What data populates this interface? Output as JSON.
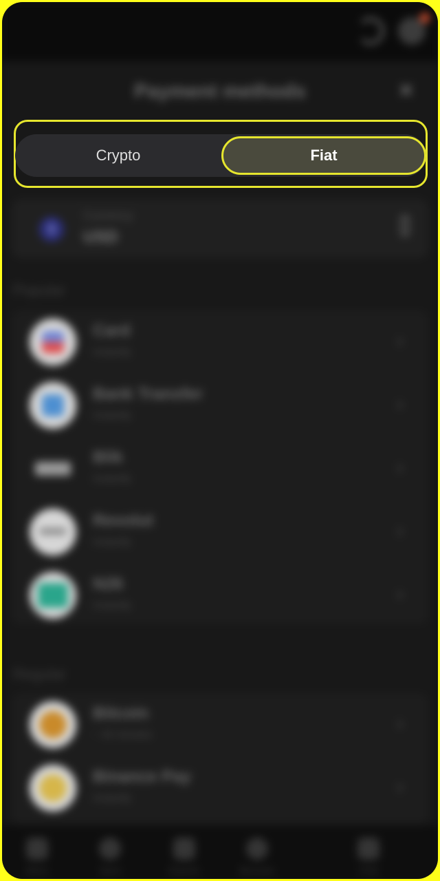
{
  "sheet": {
    "title": "Payment methods"
  },
  "toggle": {
    "crypto_label": "Crypto",
    "fiat_label": "Fiat",
    "selected": "Fiat"
  },
  "currency": {
    "label": "Currency",
    "value": "USD",
    "symbol": "$"
  },
  "popular": {
    "heading": "Popular",
    "items": [
      {
        "name": "Card",
        "time": "Instantly",
        "icon": "card-icon"
      },
      {
        "name": "Bank Transfer",
        "time": "Instantly",
        "icon": "bank-icon"
      },
      {
        "name": "Blik",
        "time": "Instantly",
        "icon": "blik-icon"
      },
      {
        "name": "Revolut",
        "time": "Instantly",
        "icon": "revolut-icon"
      },
      {
        "name": "N26",
        "time": "Instantly",
        "icon": "n26-icon"
      }
    ]
  },
  "regular": {
    "heading": "Regular",
    "items": [
      {
        "name": "Bitcoin",
        "time": "~ 40 minutes",
        "icon": "bitcoin-icon"
      },
      {
        "name": "Binance Pay",
        "time": "Instantly",
        "icon": "binance-pay-icon"
      }
    ]
  },
  "bottom_nav": {
    "items": [
      {
        "label": "Menu"
      },
      {
        "label": "Sport"
      },
      {
        "label": "Esports"
      },
      {
        "label": "Bonuses"
      },
      {
        "label": "Chat"
      }
    ]
  },
  "colors": {
    "accent": "#e6e62e",
    "background": "#181818",
    "selected_segment": "#4a4a3d"
  }
}
